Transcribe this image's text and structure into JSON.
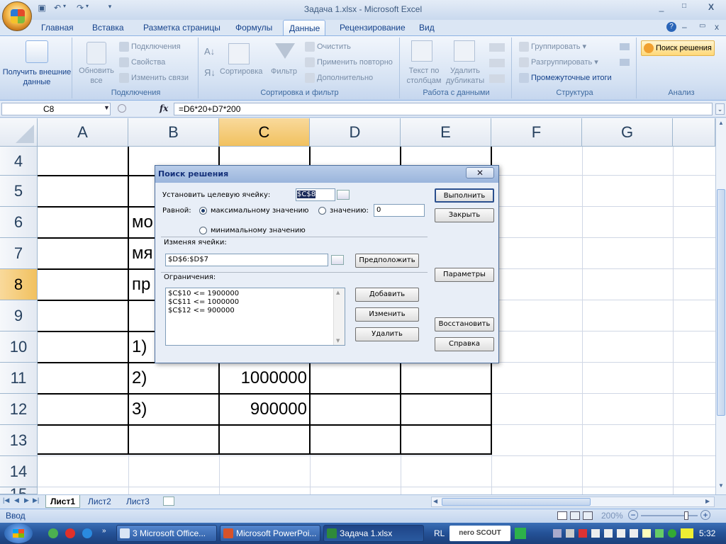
{
  "window": {
    "title": "Задача 1.xlsx - Microsoft Excel",
    "minimize": "_",
    "maximize": "□",
    "close": "X"
  },
  "qat": {
    "save_icon": "save-icon",
    "undo_icon": "undo-icon",
    "redo_icon": "redo-icon"
  },
  "tabs": [
    "Главная",
    "Вставка",
    "Разметка страницы",
    "Формулы",
    "Данные",
    "Рецензирование",
    "Вид"
  ],
  "ribbon": {
    "get_external": "Получить внешние данные",
    "refresh_all": "Обновить все",
    "connections": "Подключения",
    "properties": "Свойства",
    "edit_links": "Изменить связи",
    "group_connections": "Подключения",
    "sort": "Сортировка",
    "filter": "Фильтр",
    "clear": "Очистить",
    "reapply": "Применить повторно",
    "advanced": "Дополнительно",
    "group_sort": "Сортировка и фильтр",
    "text_to_columns": "Текст по столбцам",
    "remove_duplicates": "Удалить дубликаты",
    "group_data_tools": "Работа с данными",
    "group": "Группировать",
    "ungroup": "Разгруппировать",
    "subtotal": "Промежуточные итоги",
    "group_outline": "Структура",
    "solver": "Поиск решения",
    "group_analysis": "Анализ"
  },
  "formula_bar": {
    "name_box": "C8",
    "fx": "fx",
    "formula": "=D6*20+D7*200"
  },
  "columns": [
    "A",
    "B",
    "C",
    "D",
    "E",
    "F",
    "G"
  ],
  "rows": [
    "4",
    "5",
    "6",
    "7",
    "8",
    "9",
    "10",
    "11",
    "12",
    "13",
    "14",
    "15"
  ],
  "cells": {
    "B6": "мо",
    "B7": "мя",
    "B8": "пр",
    "B10": "1)",
    "B11": "2)",
    "B12": "3)",
    "C11": "1000000",
    "C12": "900000"
  },
  "sheets": [
    "Лист1",
    "Лист2",
    "Лист3"
  ],
  "status": {
    "mode": "Ввод",
    "zoom": "200%"
  },
  "dialog": {
    "title": "Поиск решения",
    "close": "✕",
    "target_label": "Установить целевую ячейку:",
    "target_value": "$C$8",
    "equal_label": "Равной:",
    "opt_max": "максимальному значению",
    "opt_value": "значению:",
    "value_input": "0",
    "opt_min": "минимальному значению",
    "changing_label": "Изменяя ячейки:",
    "changing_value": "$D$6:$D$7",
    "guess_btn": "Предположить",
    "constraints_label": "Ограничения:",
    "constraints": [
      "$C$10 <= 1900000",
      "$C$11 <= 1000000",
      "$C$12 <= 900000"
    ],
    "add_btn": "Добавить",
    "change_btn": "Изменить",
    "delete_btn": "Удалить",
    "solve_btn": "Выполнить",
    "close_btn": "Закрыть",
    "options_btn": "Параметры",
    "reset_btn": "Восстановить",
    "help_btn": "Справка"
  },
  "taskbar": {
    "items": [
      "3 Microsoft Office...",
      "Microsoft PowerPoi...",
      "Задача 1.xlsx"
    ],
    "lang": "RL",
    "nero": "nero SCOUT",
    "clock": "5:32"
  }
}
